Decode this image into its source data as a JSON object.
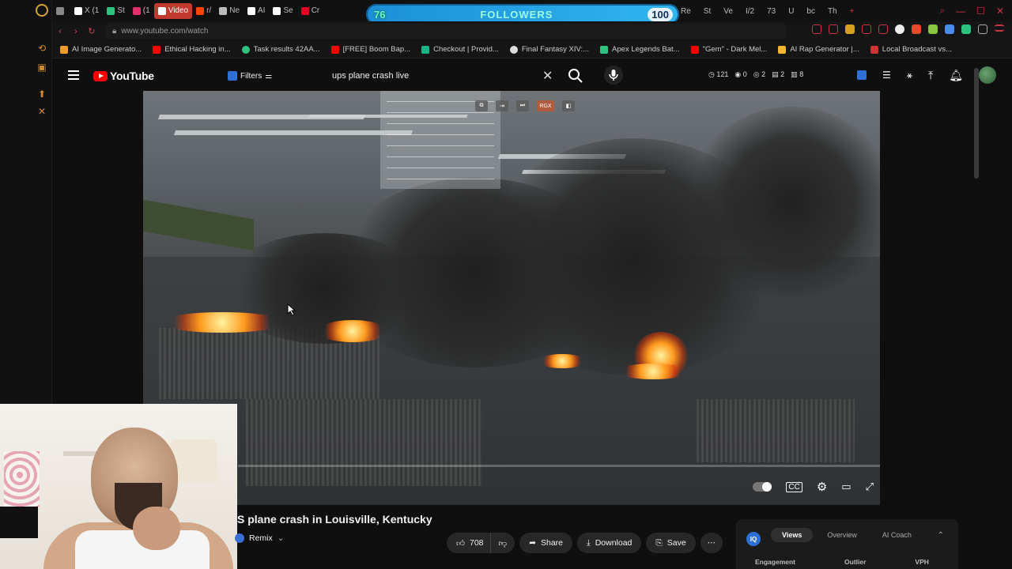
{
  "browser": {
    "tabs": [
      {
        "label": "",
        "color": "#d0d0d0"
      },
      {
        "label": "X (1",
        "color": "#ffffff"
      },
      {
        "label": "St",
        "color": "#2ec27e"
      },
      {
        "label": "(1",
        "color": "#e1306c"
      },
      {
        "label": "Video",
        "color": "#ff3333"
      },
      {
        "label": "r/",
        "color": "#ff4500"
      },
      {
        "label": "Ne",
        "color": "#bbbbbb"
      },
      {
        "label": "AI",
        "color": "#ffffff"
      },
      {
        "label": "Se",
        "color": "#ffffff"
      },
      {
        "label": "Cr",
        "color": "#e60023"
      }
    ],
    "right_tabs": [
      "Re",
      "St",
      "Ve",
      "I/2",
      "73",
      "U",
      "bc",
      "Th"
    ],
    "url": "www.youtube.com/watch",
    "bookmarks": [
      {
        "label": "AI Image Generato...",
        "color": "#f29b2b"
      },
      {
        "label": "Ethical Hacking in...",
        "color": "#ff0000"
      },
      {
        "label": "Task results 42AA...",
        "color": "#2ec27e"
      },
      {
        "label": "[FREE] Boom Bap...",
        "color": "#ff0000"
      },
      {
        "label": "Checkout | Provid...",
        "color": "#19b38a"
      },
      {
        "label": "Final Fantasy XIV:...",
        "color": "#dddddd"
      },
      {
        "label": "Apex Legends Bat...",
        "color": "#2ec27e"
      },
      {
        "label": "\"Gem\" - Dark Mel...",
        "color": "#ff0000"
      },
      {
        "label": "AI Rap Generator |...",
        "color": "#f2b632"
      },
      {
        "label": "Local Broadcast vs...",
        "color": "#cc3333"
      }
    ]
  },
  "followers_widget": {
    "current": "76",
    "label": "FOLLOWERS",
    "goal": "100"
  },
  "youtube": {
    "logo_text": "YouTube",
    "filters_label": "Filters",
    "search_query": "ups plane crash live",
    "header_stats": [
      "121",
      "0",
      "2",
      "2",
      "8"
    ]
  },
  "overlay": {
    "rgx_label": "RGX"
  },
  "video": {
    "title": "S plane crash in Louisville, Kentucky",
    "remix_label": "Remix",
    "likes": "708",
    "share_label": "Share",
    "download_label": "Download",
    "save_label": "Save"
  },
  "side_panel": {
    "badge": "IQ",
    "tabs": [
      "Views",
      "Overview",
      "AI Coach"
    ],
    "columns": [
      "Engagement",
      "Outlier",
      "VPH"
    ]
  }
}
